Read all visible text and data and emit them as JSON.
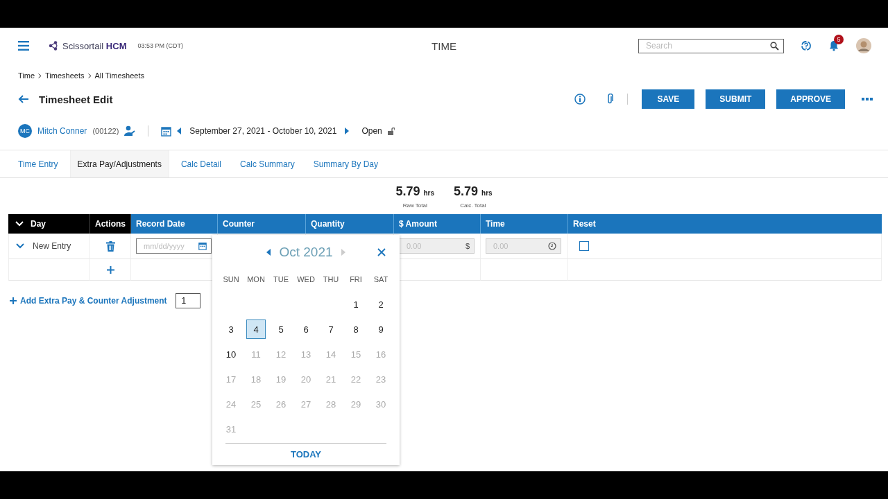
{
  "header": {
    "brand": "Scissortail",
    "brand_bold": "HCM",
    "clock": "03:53 PM (CDT)",
    "module": "TIME",
    "search": {
      "placeholder": "Search"
    },
    "notifications": "5"
  },
  "breadcrumb": [
    "Time",
    "Timesheets",
    "All Timesheets"
  ],
  "page": {
    "title": "Timesheet Edit",
    "actions": [
      "SAVE",
      "SUBMIT",
      "APPROVE"
    ]
  },
  "employee": {
    "initials": "MC",
    "name": "Mitch Conner",
    "number": "(00122)",
    "period": "September 27, 2021 - October 10, 2021",
    "status": "Open"
  },
  "tabs": [
    {
      "label": "Time Entry",
      "selected": false
    },
    {
      "label": "Extra Pay/Adjustments",
      "selected": true
    },
    {
      "label": "Calc Detail",
      "selected": false
    },
    {
      "label": "Calc Summary",
      "selected": false
    },
    {
      "label": "Summary By Day",
      "selected": false
    }
  ],
  "totals": [
    {
      "value": "5.79",
      "unit": "hrs",
      "label": "Raw Total"
    },
    {
      "value": "5.79",
      "unit": "hrs",
      "label": "Calc. Total"
    }
  ],
  "table": {
    "columns": [
      {
        "label": "Day",
        "kind": "dark"
      },
      {
        "label": "Actions",
        "kind": "dark"
      },
      {
        "label": "Record Date",
        "kind": "blue"
      },
      {
        "label": "Counter",
        "kind": "blue"
      },
      {
        "label": "Quantity",
        "kind": "blue"
      },
      {
        "label": "$ Amount",
        "kind": "blue"
      },
      {
        "label": "Time",
        "kind": "blue"
      },
      {
        "label": "Reset",
        "kind": "blue"
      }
    ],
    "entry": {
      "label": "New Entry",
      "expanded": true,
      "record_date": {
        "placeholder": "mm/dd/yyyy"
      },
      "amount": {
        "placeholder": "0.00",
        "symbol": "$",
        "disabled": true
      },
      "time": {
        "placeholder": "0.00",
        "disabled": true
      },
      "reset": {
        "checked": false
      }
    }
  },
  "add_link": {
    "label": "Add Extra Pay & Counter Adjustment",
    "count": "1"
  },
  "calendar": {
    "month": "Oct 2021",
    "weekdays": [
      "SUN",
      "MON",
      "TUE",
      "WED",
      "THU",
      "FRI",
      "SAT"
    ],
    "weeks": [
      {
        "kind": "end",
        "days": [
          {
            "day": "1",
            "disabled": false,
            "selected": false
          },
          {
            "day": "2",
            "disabled": false,
            "selected": false
          }
        ]
      },
      {
        "kind": "start",
        "days": [
          {
            "day": "3",
            "disabled": false,
            "selected": false
          },
          {
            "day": "4",
            "disabled": false,
            "selected": true
          },
          {
            "day": "5",
            "disabled": false,
            "selected": false
          },
          {
            "day": "6",
            "disabled": false,
            "selected": false
          },
          {
            "day": "7",
            "disabled": false,
            "selected": false
          },
          {
            "day": "8",
            "disabled": false,
            "selected": false
          },
          {
            "day": "9",
            "disabled": false,
            "selected": false
          }
        ]
      },
      {
        "kind": "start",
        "days": [
          {
            "day": "10",
            "disabled": false,
            "selected": false
          },
          {
            "day": "11",
            "disabled": true,
            "selected": false
          },
          {
            "day": "12",
            "disabled": true,
            "selected": false
          },
          {
            "day": "13",
            "disabled": true,
            "selected": false
          },
          {
            "day": "14",
            "disabled": true,
            "selected": false
          },
          {
            "day": "15",
            "disabled": true,
            "selected": false
          },
          {
            "day": "16",
            "disabled": true,
            "selected": false
          }
        ]
      },
      {
        "kind": "start",
        "days": [
          {
            "day": "17",
            "disabled": true,
            "selected": false
          },
          {
            "day": "18",
            "disabled": true,
            "selected": false
          },
          {
            "day": "19",
            "disabled": true,
            "selected": false
          },
          {
            "day": "20",
            "disabled": true,
            "selected": false
          },
          {
            "day": "21",
            "disabled": true,
            "selected": false
          },
          {
            "day": "22",
            "disabled": true,
            "selected": false
          },
          {
            "day": "23",
            "disabled": true,
            "selected": false
          }
        ]
      },
      {
        "kind": "start",
        "days": [
          {
            "day": "24",
            "disabled": true,
            "selected": false
          },
          {
            "day": "25",
            "disabled": true,
            "selected": false
          },
          {
            "day": "26",
            "disabled": true,
            "selected": false
          },
          {
            "day": "27",
            "disabled": true,
            "selected": false
          },
          {
            "day": "28",
            "disabled": true,
            "selected": false
          },
          {
            "day": "29",
            "disabled": true,
            "selected": false
          },
          {
            "day": "30",
            "disabled": true,
            "selected": false
          }
        ]
      },
      {
        "kind": "start",
        "days": [
          {
            "day": "31",
            "disabled": true,
            "selected": false
          }
        ]
      }
    ],
    "today": "TODAY"
  }
}
